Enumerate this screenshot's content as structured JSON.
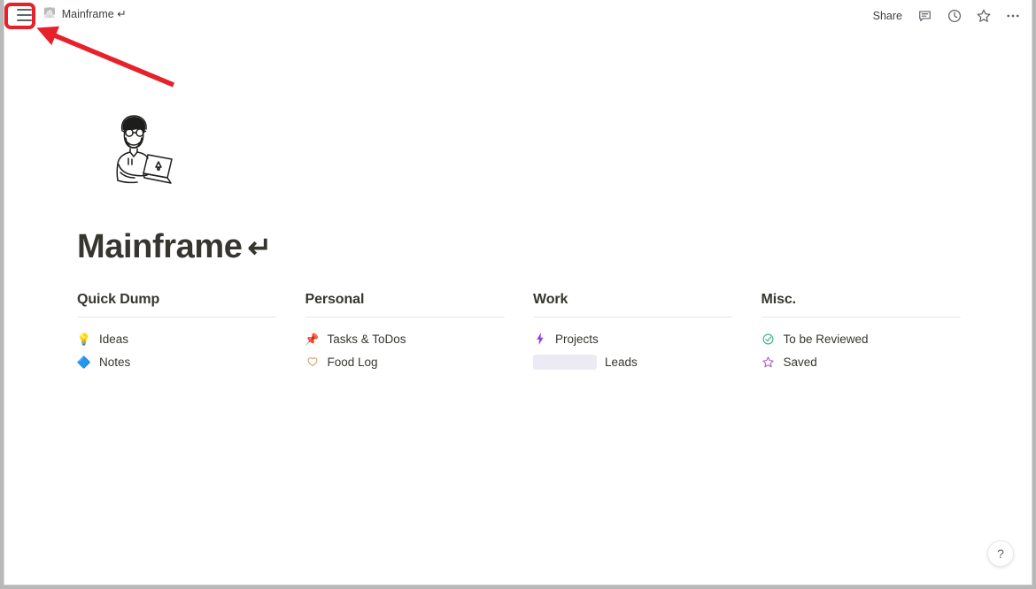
{
  "topbar": {
    "menu_icon": "hamburger-menu-icon",
    "breadcrumb": {
      "page_icon": "page-emoji-icon",
      "icon_glyph": "🧑‍💻",
      "label": "Mainframe ↵"
    },
    "share_label": "Share",
    "icons": [
      {
        "name": "comment-icon",
        "title": "Comments"
      },
      {
        "name": "history-clock-icon",
        "title": "Updates & history"
      },
      {
        "name": "favorite-star-icon",
        "title": "Add to favorites"
      },
      {
        "name": "more-options-icon",
        "title": "More"
      }
    ]
  },
  "page": {
    "illustration_name": "person-with-laptop-illustration",
    "title": "Mainframe",
    "title_emoji": "↵"
  },
  "columns": [
    {
      "header": "Quick Dump",
      "links": [
        {
          "icon": "lightbulb-icon",
          "glyph": "💡",
          "label": "Ideas",
          "placeholder": false
        },
        {
          "icon": "blue-diamond-icon",
          "glyph": "🔷",
          "label": "Notes",
          "placeholder": false
        }
      ]
    },
    {
      "header": "Personal",
      "links": [
        {
          "icon": "pushpin-icon",
          "glyph": "📌",
          "label": "Tasks & ToDos",
          "placeholder": false
        },
        {
          "icon": "heart-outline-icon",
          "glyph": "🤍",
          "label": "Food Log",
          "placeholder": false
        }
      ]
    },
    {
      "header": "Work",
      "links": [
        {
          "icon": "lightning-bolt-icon",
          "glyph": "⚡",
          "label": "Projects",
          "placeholder": false
        },
        {
          "icon": "loading-placeholder-icon",
          "glyph": "",
          "label": "Leads",
          "placeholder": true
        }
      ]
    },
    {
      "header": "Misc.",
      "links": [
        {
          "icon": "check-circle-icon",
          "glyph": "✅",
          "label": "To be Reviewed",
          "placeholder": false
        },
        {
          "icon": "star-outline-icon",
          "glyph": "⭐",
          "label": "Saved",
          "placeholder": false
        }
      ]
    }
  ],
  "help": {
    "label": "?"
  },
  "annotation": {
    "highlight_color": "#e8202a",
    "target": "hamburger-menu-icon"
  }
}
